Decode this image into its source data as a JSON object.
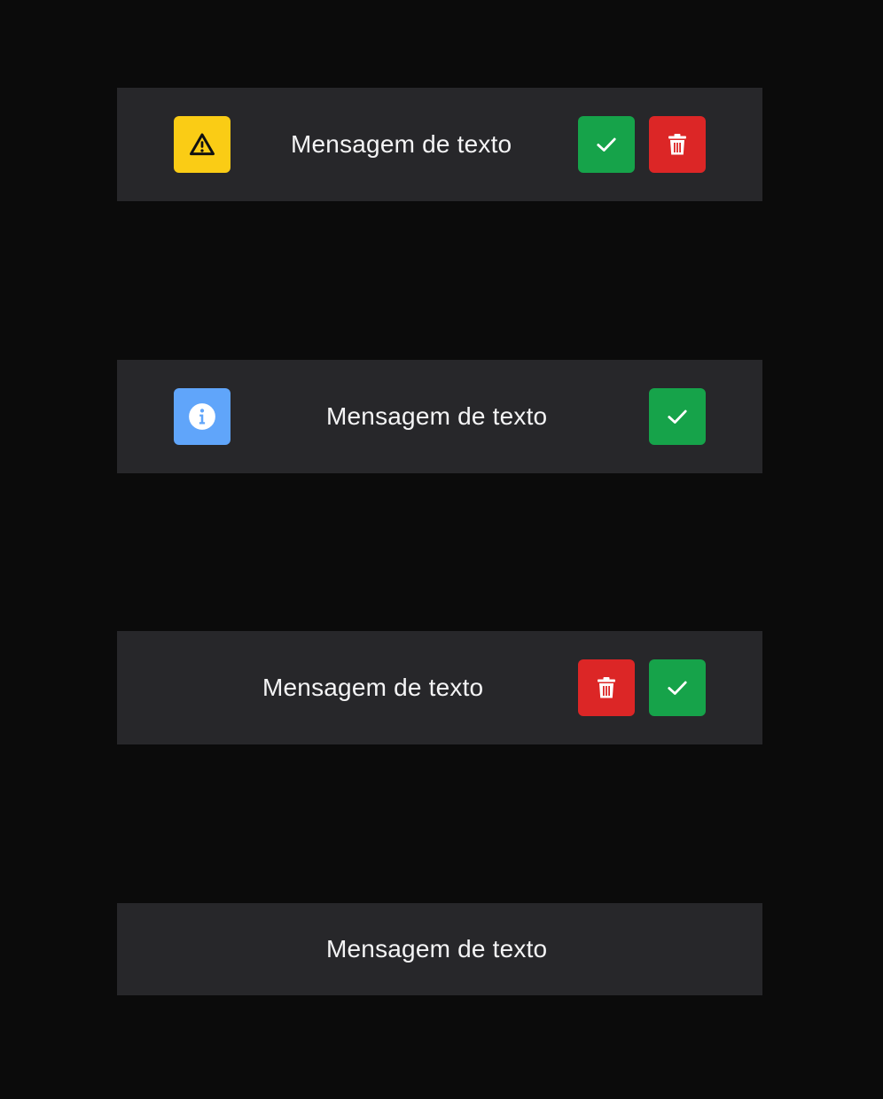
{
  "colors": {
    "page_background": "#0b0b0b",
    "toast_background": "#27272a",
    "warning": "#facc15",
    "info": "#60a5fa",
    "confirm": "#16a34a",
    "delete": "#dc2626",
    "text": "#f4f4f5"
  },
  "toasts": [
    {
      "variant": "warning",
      "status_icon": "warning-triangle-icon",
      "message": "Mensagem de texto",
      "actions": [
        "confirm",
        "delete"
      ]
    },
    {
      "variant": "info",
      "status_icon": "info-circle-icon",
      "message": "Mensagem de texto",
      "actions": [
        "confirm"
      ]
    },
    {
      "variant": "plain",
      "status_icon": "",
      "message": "Mensagem de texto",
      "actions": [
        "delete",
        "confirm"
      ]
    },
    {
      "variant": "plain",
      "status_icon": "",
      "message": "Mensagem de texto",
      "actions": []
    }
  ],
  "icons": {
    "confirm": "check-icon",
    "delete": "trash-icon"
  }
}
